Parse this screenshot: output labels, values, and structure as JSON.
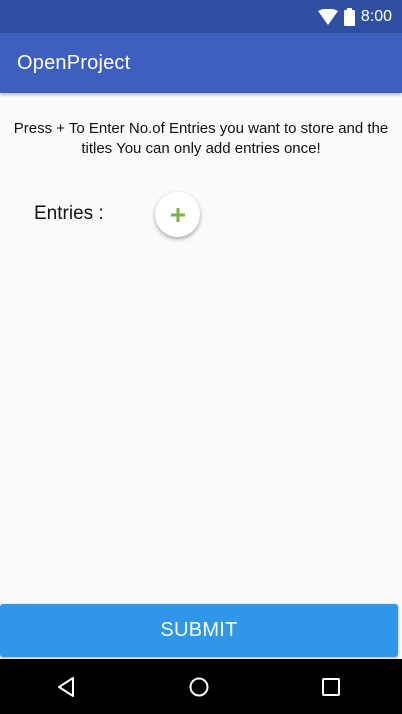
{
  "status_bar": {
    "time": "8:00",
    "icons": [
      "wifi-icon",
      "battery-icon"
    ]
  },
  "app_bar": {
    "title": "OpenProject"
  },
  "content": {
    "instructions": "Press + To Enter No.of Entries you want to store and the titles You can only add entries once!",
    "entries_label": "Entries :",
    "add_button_icon": "plus-icon"
  },
  "submit": {
    "label": "SUBMIT"
  },
  "nav_bar": {
    "icons": [
      "back-icon",
      "home-icon",
      "recents-icon"
    ]
  },
  "colors": {
    "status_bar": "#2f4fa3",
    "app_bar": "#3f5fbf",
    "background": "#fafafa",
    "accent_plus": "#7cb342",
    "submit_button": "#2f96ea",
    "nav_bar": "#000000"
  }
}
